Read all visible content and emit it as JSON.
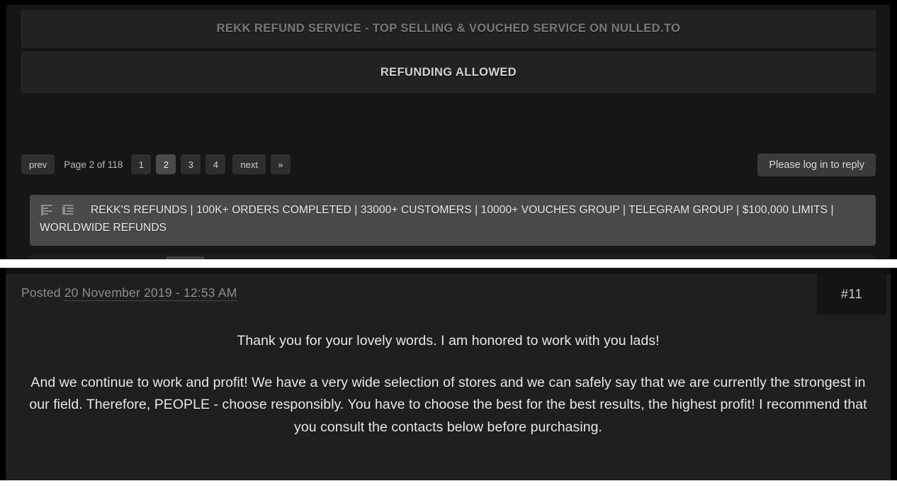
{
  "top_panel": {
    "banner_title": "REKK REFUND SERVICE - TOP SELLING & VOUCHED SERVICE ON NULLED.TO",
    "banner_subtitle": "REFUNDING ALLOWED",
    "pagination": {
      "prev_label": "prev",
      "page_status": "Page 2 of 118",
      "pages": [
        "1",
        "2",
        "3",
        "4"
      ],
      "active_page": "2",
      "next_label": "next",
      "last_label": "»"
    },
    "reply_button_label": "Please log in to reply",
    "signature": {
      "icons": [
        "align-left-icon",
        "outdent-icon"
      ],
      "text": "REKK'S REFUNDS | 100K+ ORDERS COMPLETED | 33000+ CUSTOMERS | 10000+ VOUCHES GROUP | TELEGRAM GROUP | $100,000 LIMITS | WORLDWIDE REFUNDS"
    }
  },
  "bottom_panel": {
    "posted_prefix": "Posted",
    "posted_date": "20 November 2019 - 12:53 AM",
    "post_number": "#11",
    "paragraphs": [
      "Thank you for your lovely words. I am honored to work with you lads!",
      "And we continue to work and profit! We have a very wide selection of stores and we can safely say that we are currently the strongest in our field. Therefore, PEOPLE - choose responsibly. You have to choose the best for the best results, the highest profit! I recommend that you consult the contacts below before purchasing."
    ]
  },
  "colors": {
    "page_background": "#161616",
    "panel_background": "#1f1f1f",
    "banner_background": "#222222",
    "signature_background": "#4a4a4a",
    "active_page_background": "#4a4a4a",
    "separator": "#ffffff",
    "body_text": "#e9eaea",
    "muted_text": "#8b8e8f"
  }
}
